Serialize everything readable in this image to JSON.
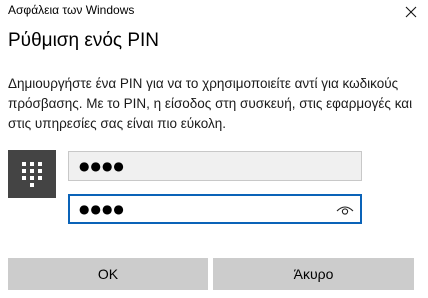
{
  "window": {
    "title": "Ασφάλεια των Windows",
    "close_icon": "close-icon"
  },
  "dialog": {
    "heading": "Ρύθμιση ενός PIN",
    "description": "Δημιουργήστε ένα PIN για να το χρησιμοποιείτε αντί για κωδικούς πρόσβασης. Με το PIN, η είσοδος στη συσκευή, στις εφαρμογές και στις υπηρεσίες σας είναι πιο εύκολη."
  },
  "pin": {
    "keypad_icon": "keypad-icon",
    "new_pin_value": "●●●●",
    "confirm_pin_value": "●●●●",
    "reveal_icon": "eye-icon"
  },
  "buttons": {
    "ok_label": "OK",
    "cancel_label": "Άκυρο"
  },
  "colors": {
    "focus_border": "#0a63b8",
    "button_bg": "#cccccc",
    "keypad_tile_bg": "#444444"
  }
}
